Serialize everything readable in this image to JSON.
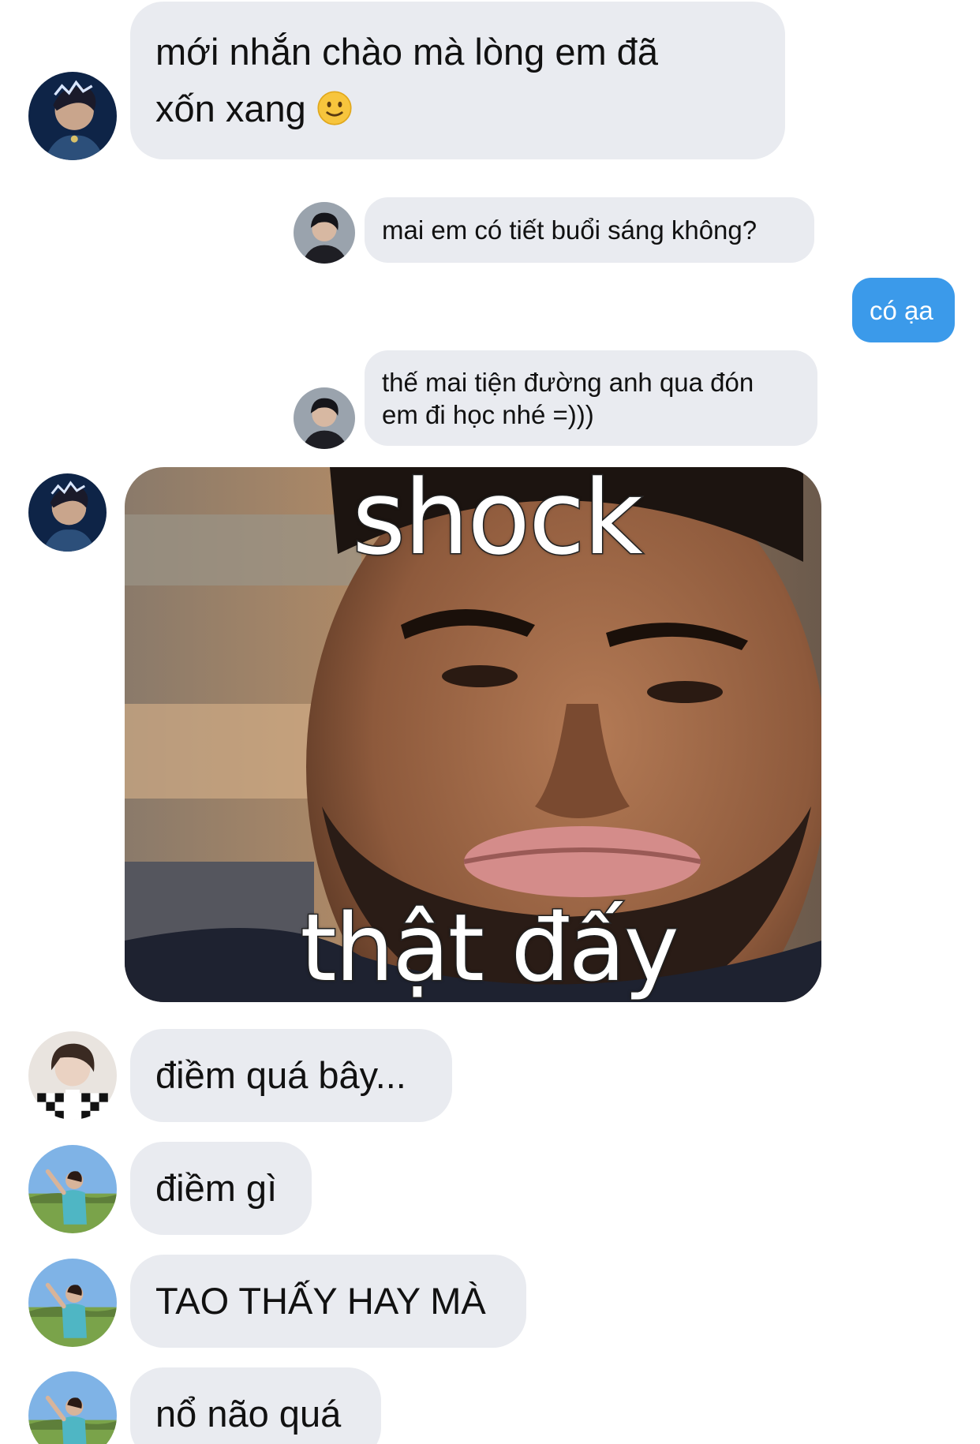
{
  "messages": [
    {
      "text": "mới nhắn chào mà lòng em đã",
      "text2": "xốn xang",
      "emoji": "slightly-smiling-face"
    },
    {
      "text": "mai em có tiết buổi sáng không?"
    },
    {
      "text": "có ạa"
    },
    {
      "text": "thế mai tiện đường anh qua đón",
      "text2": "em đi học nhé =)))"
    },
    {
      "meme_top": "shock",
      "meme_bottom": "thật đấy"
    },
    {
      "text": "điềm quá bây..."
    },
    {
      "text": "điềm gì"
    },
    {
      "text": "TAO THẤY HAY MÀ"
    },
    {
      "text": "nổ não quá"
    }
  ],
  "colors": {
    "incoming_bubble": "#e9ebf0",
    "outgoing_bubble": "#3b9aea"
  }
}
